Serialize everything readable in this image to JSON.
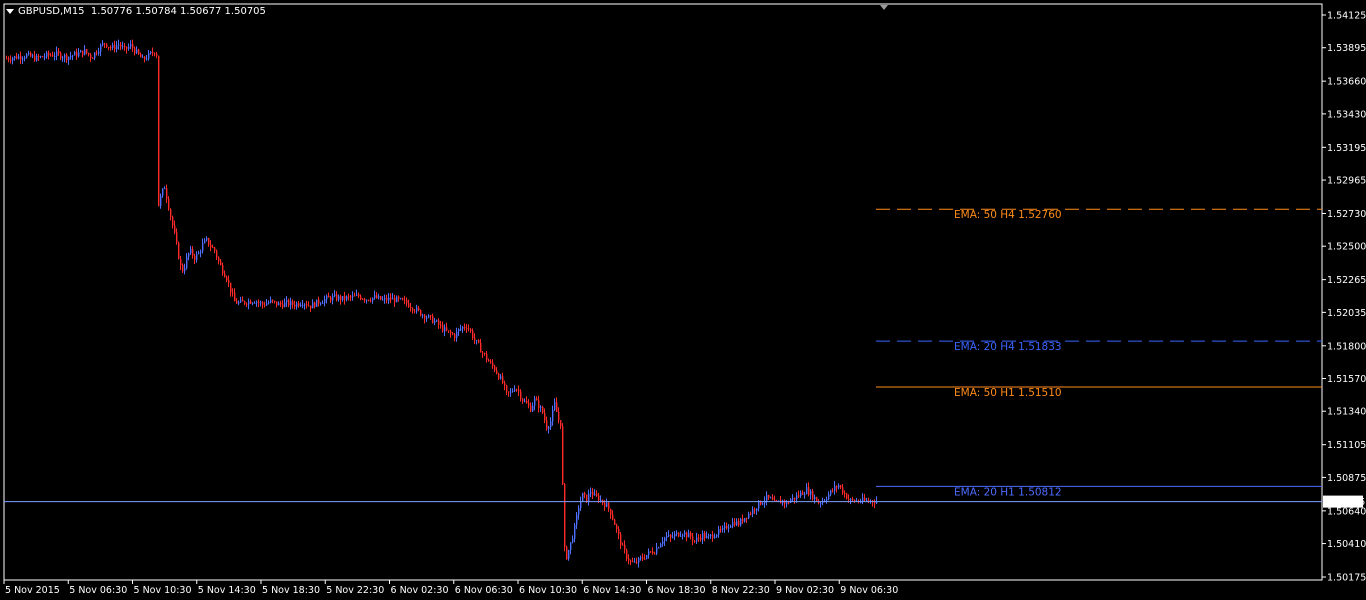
{
  "header": {
    "symbol": "GBPUSD,M15",
    "open": "1.50776",
    "high": "1.50784",
    "low": "1.50677",
    "close": "1.50705"
  },
  "colors": {
    "background": "#000000",
    "axis": "#ffffff",
    "bull_candle": "#4f6fff",
    "bear_candle": "#ff2a2a",
    "ema_h4_50": "#ff8c1a",
    "ema_h4_20": "#3a64ff",
    "ema_h1_50": "#ff8c1a",
    "ema_h1_20": "#4d6bff",
    "bid_line": "#7f9fff"
  },
  "price_axis": {
    "ticks": [
      "1.54125",
      "1.53895",
      "1.53660",
      "1.53430",
      "1.53195",
      "1.52965",
      "1.52730",
      "1.52500",
      "1.52265",
      "1.52035",
      "1.51800",
      "1.51570",
      "1.51340",
      "1.51105",
      "1.50875",
      "1.50640",
      "1.50410",
      "1.50175"
    ],
    "current_price": "1.50705"
  },
  "time_axis": {
    "ticks": [
      "5 Nov 2015",
      "5 Nov 06:30",
      "5 Nov 10:30",
      "5 Nov 14:30",
      "5 Nov 18:30",
      "5 Nov 22:30",
      "6 Nov 02:30",
      "6 Nov 06:30",
      "6 Nov 10:30",
      "6 Nov 14:30",
      "6 Nov 18:30",
      "8 Nov 22:30",
      "9 Nov 02:30",
      "9 Nov 06:30"
    ]
  },
  "ema_lines": [
    {
      "label": "EMA: 50  H4 1.52760",
      "value": 1.5276,
      "style": "dashed",
      "color_key": "ema_h4_50"
    },
    {
      "label": "EMA: 20  H4 1.51833",
      "value": 1.51833,
      "style": "dashed",
      "color_key": "ema_h4_20"
    },
    {
      "label": "EMA: 50  H1 1.51510",
      "value": 1.5151,
      "style": "solid",
      "color_key": "ema_h1_50"
    },
    {
      "label": "EMA: 20  H1 1.50812",
      "value": 1.50812,
      "style": "solid",
      "color_key": "ema_h1_20"
    }
  ],
  "price_path": [
    [
      0,
      1.5382
    ],
    [
      10,
      1.5383
    ],
    [
      20,
      1.5384
    ],
    [
      30,
      1.5382
    ],
    [
      40,
      1.5384
    ],
    [
      50,
      1.5385
    ],
    [
      60,
      1.5383
    ],
    [
      70,
      1.5385
    ],
    [
      78,
      1.5387
    ],
    [
      85,
      1.5383
    ],
    [
      92,
      1.5389
    ],
    [
      98,
      1.5393
    ],
    [
      105,
      1.5389
    ],
    [
      112,
      1.5392
    ],
    [
      118,
      1.5388
    ],
    [
      124,
      1.5391
    ],
    [
      130,
      1.5386
    ],
    [
      136,
      1.5381
    ],
    [
      142,
      1.5384
    ],
    [
      148,
      1.5387
    ],
    [
      150,
      1.5385
    ],
    [
      151,
      1.529
    ],
    [
      152,
      1.5279
    ],
    [
      155,
      1.5287
    ],
    [
      158,
      1.5292
    ],
    [
      162,
      1.5278
    ],
    [
      165,
      1.5268
    ],
    [
      168,
      1.5258
    ],
    [
      172,
      1.5243
    ],
    [
      175,
      1.5232
    ],
    [
      178,
      1.5236
    ],
    [
      181,
      1.5244
    ],
    [
      184,
      1.5246
    ],
    [
      188,
      1.5242
    ],
    [
      192,
      1.5245
    ],
    [
      196,
      1.5251
    ],
    [
      200,
      1.5254
    ],
    [
      204,
      1.525
    ],
    [
      208,
      1.5247
    ],
    [
      212,
      1.5239
    ],
    [
      216,
      1.5233
    ],
    [
      220,
      1.5228
    ],
    [
      224,
      1.5219
    ],
    [
      228,
      1.5211
    ],
    [
      232,
      1.521
    ],
    [
      240,
      1.5211
    ],
    [
      248,
      1.5212
    ],
    [
      256,
      1.5209
    ],
    [
      264,
      1.5211
    ],
    [
      272,
      1.5209
    ],
    [
      280,
      1.521
    ],
    [
      288,
      1.5209
    ],
    [
      296,
      1.5211
    ],
    [
      304,
      1.5208
    ],
    [
      312,
      1.5211
    ],
    [
      320,
      1.5213
    ],
    [
      328,
      1.5214
    ],
    [
      336,
      1.5213
    ],
    [
      344,
      1.5214
    ],
    [
      352,
      1.5215
    ],
    [
      360,
      1.5213
    ],
    [
      368,
      1.5214
    ],
    [
      376,
      1.5212
    ],
    [
      384,
      1.5213
    ],
    [
      392,
      1.5212
    ],
    [
      400,
      1.521
    ],
    [
      408,
      1.5206
    ],
    [
      416,
      1.5202
    ],
    [
      424,
      1.5199
    ],
    [
      430,
      1.5196
    ],
    [
      436,
      1.5192
    ],
    [
      442,
      1.5189
    ],
    [
      448,
      1.5187
    ],
    [
      452,
      1.5191
    ],
    [
      456,
      1.5193
    ],
    [
      460,
      1.5194
    ],
    [
      464,
      1.519
    ],
    [
      468,
      1.5184
    ],
    [
      472,
      1.518
    ],
    [
      476,
      1.5175
    ],
    [
      480,
      1.5171
    ],
    [
      484,
      1.5167
    ],
    [
      488,
      1.5164
    ],
    [
      492,
      1.5159
    ],
    [
      496,
      1.5154
    ],
    [
      500,
      1.5146
    ],
    [
      504,
      1.5147
    ],
    [
      508,
      1.5151
    ],
    [
      512,
      1.5148
    ],
    [
      516,
      1.5142
    ],
    [
      520,
      1.5139
    ],
    [
      524,
      1.5136
    ],
    [
      528,
      1.5142
    ],
    [
      532,
      1.5138
    ],
    [
      536,
      1.5133
    ],
    [
      540,
      1.5123
    ],
    [
      544,
      1.5127
    ],
    [
      548,
      1.5139
    ],
    [
      552,
      1.5128
    ],
    [
      555,
      1.5124
    ],
    [
      557,
      1.5039
    ],
    [
      560,
      1.5032
    ],
    [
      564,
      1.5041
    ],
    [
      568,
      1.5052
    ],
    [
      572,
      1.5067
    ],
    [
      576,
      1.5075
    ],
    [
      580,
      1.5072
    ],
    [
      584,
      1.5078
    ],
    [
      588,
      1.5074
    ],
    [
      592,
      1.5073
    ],
    [
      596,
      1.507
    ],
    [
      600,
      1.5068
    ],
    [
      604,
      1.5063
    ],
    [
      608,
      1.5055
    ],
    [
      612,
      1.5046
    ],
    [
      616,
      1.5038
    ],
    [
      620,
      1.5032
    ],
    [
      624,
      1.5028
    ],
    [
      628,
      1.5027
    ],
    [
      632,
      1.5029
    ],
    [
      636,
      1.5031
    ],
    [
      640,
      1.5033
    ],
    [
      644,
      1.5035
    ],
    [
      648,
      1.5036
    ],
    [
      652,
      1.504
    ],
    [
      656,
      1.5044
    ],
    [
      660,
      1.5046
    ],
    [
      664,
      1.5045
    ],
    [
      668,
      1.5047
    ],
    [
      672,
      1.5048
    ],
    [
      676,
      1.5049
    ],
    [
      680,
      1.5047
    ],
    [
      684,
      1.5046
    ],
    [
      688,
      1.5043
    ],
    [
      692,
      1.5045
    ],
    [
      696,
      1.5047
    ],
    [
      700,
      1.5045
    ],
    [
      704,
      1.5046
    ],
    [
      708,
      1.5048
    ],
    [
      712,
      1.5049
    ],
    [
      716,
      1.505
    ],
    [
      720,
      1.5053
    ],
    [
      724,
      1.5055
    ],
    [
      728,
      1.5056
    ],
    [
      732,
      1.5055
    ],
    [
      736,
      1.5058
    ],
    [
      740,
      1.5061
    ],
    [
      744,
      1.5063
    ],
    [
      748,
      1.5066
    ],
    [
      752,
      1.5069
    ],
    [
      756,
      1.5071
    ],
    [
      760,
      1.5073
    ],
    [
      764,
      1.5072
    ],
    [
      768,
      1.5069
    ],
    [
      772,
      1.507
    ],
    [
      776,
      1.5071
    ],
    [
      780,
      1.5069
    ],
    [
      784,
      1.5072
    ],
    [
      788,
      1.5073
    ],
    [
      792,
      1.5075
    ],
    [
      796,
      1.5077
    ],
    [
      800,
      1.5079
    ],
    [
      804,
      1.5076
    ],
    [
      808,
      1.5073
    ],
    [
      812,
      1.507
    ],
    [
      816,
      1.5071
    ],
    [
      820,
      1.5074
    ],
    [
      824,
      1.5077
    ],
    [
      828,
      1.508
    ],
    [
      832,
      1.5082
    ],
    [
      836,
      1.5078
    ],
    [
      840,
      1.5074
    ],
    [
      844,
      1.5071
    ]
  ]
}
